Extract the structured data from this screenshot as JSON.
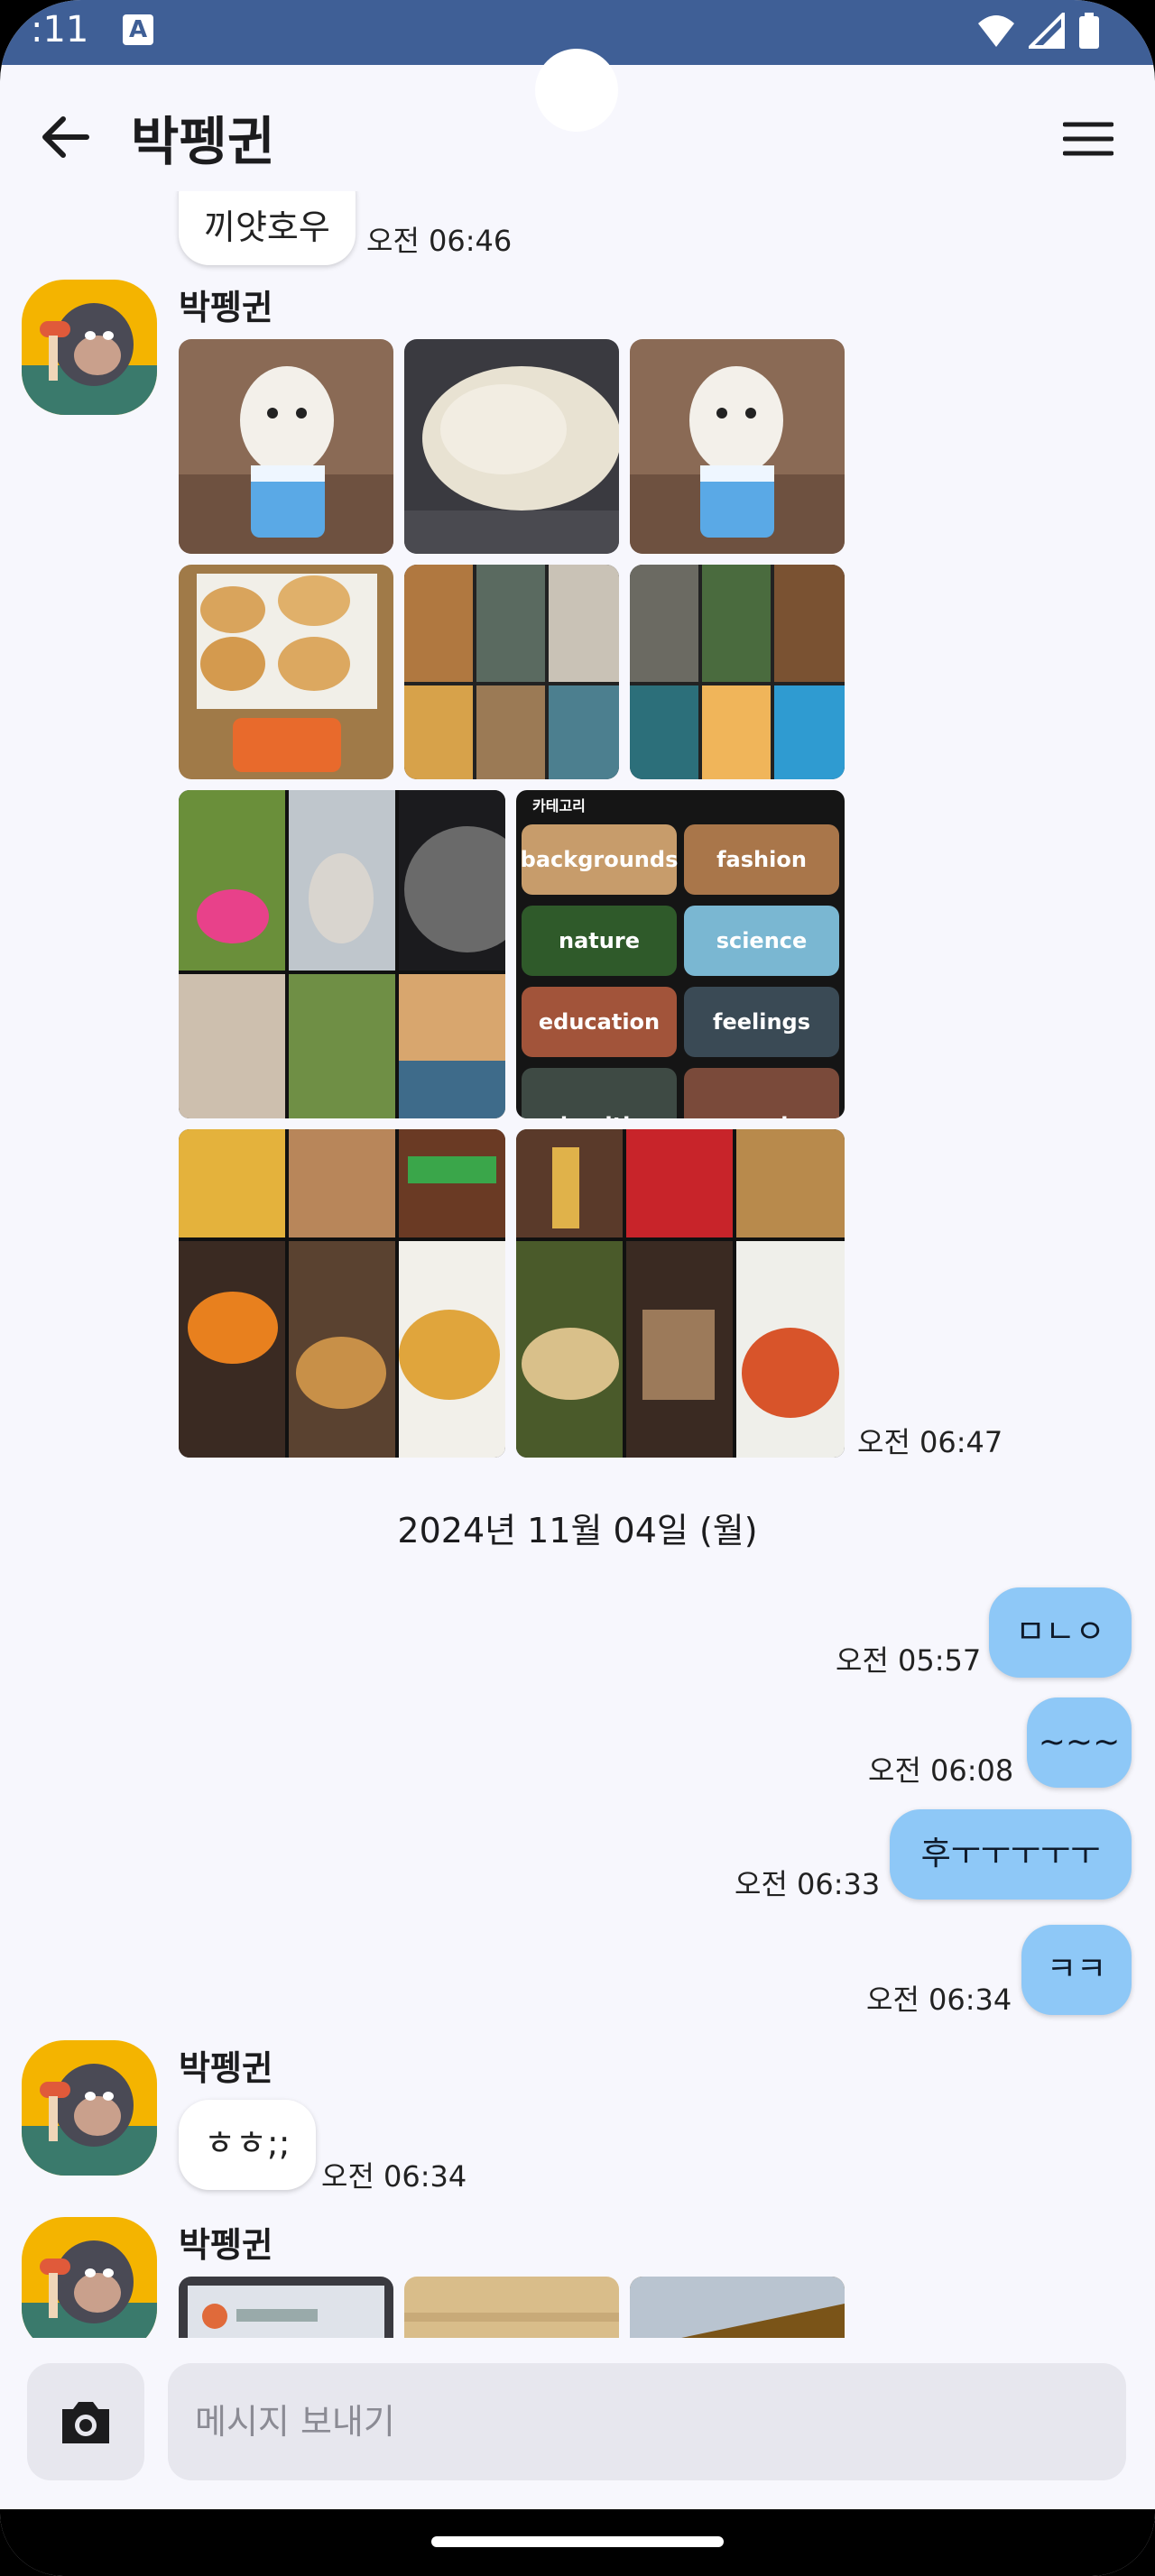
{
  "status_bar": {
    "time": ":11",
    "indicator": "A"
  },
  "header": {
    "title": "박펭귄",
    "back_icon": "arrow-left-icon",
    "menu_icon": "hamburger-menu-icon"
  },
  "messages": {
    "top_partial": {
      "text": "끼얏호우",
      "time": "오전 06:46"
    },
    "album": {
      "sender": "박펭귄",
      "time": "오전 06:47"
    },
    "category_collage": {
      "title": "카테고리",
      "chips": [
        "backgrounds",
        "fashion",
        "nature",
        "science",
        "education",
        "feelings",
        "health",
        "people"
      ]
    },
    "date_separator": "2024년 11월 04일 (월)",
    "outgoing": [
      {
        "text": "ㅁㄴㅇ",
        "time": "오전 05:57"
      },
      {
        "text": "~~~",
        "time": "오전 06:08"
      },
      {
        "text": "후ㅜㅜㅜㅜㅜ",
        "time": "오전 06:33"
      },
      {
        "text": "ㅋㅋ",
        "time": "오전 06:34"
      }
    ],
    "incoming_1": {
      "sender": "박펭귄",
      "text": "ㅎㅎ;;",
      "time": "오전 06:34"
    },
    "incoming_2": {
      "sender": "박펭귄"
    }
  },
  "composer": {
    "placeholder": "메시지 보내기",
    "camera_icon": "camera-icon"
  },
  "colors": {
    "status_bar": "#3f5f96",
    "outgoing_bubble": "#8ec8f7",
    "background": "#f7f7fd"
  }
}
